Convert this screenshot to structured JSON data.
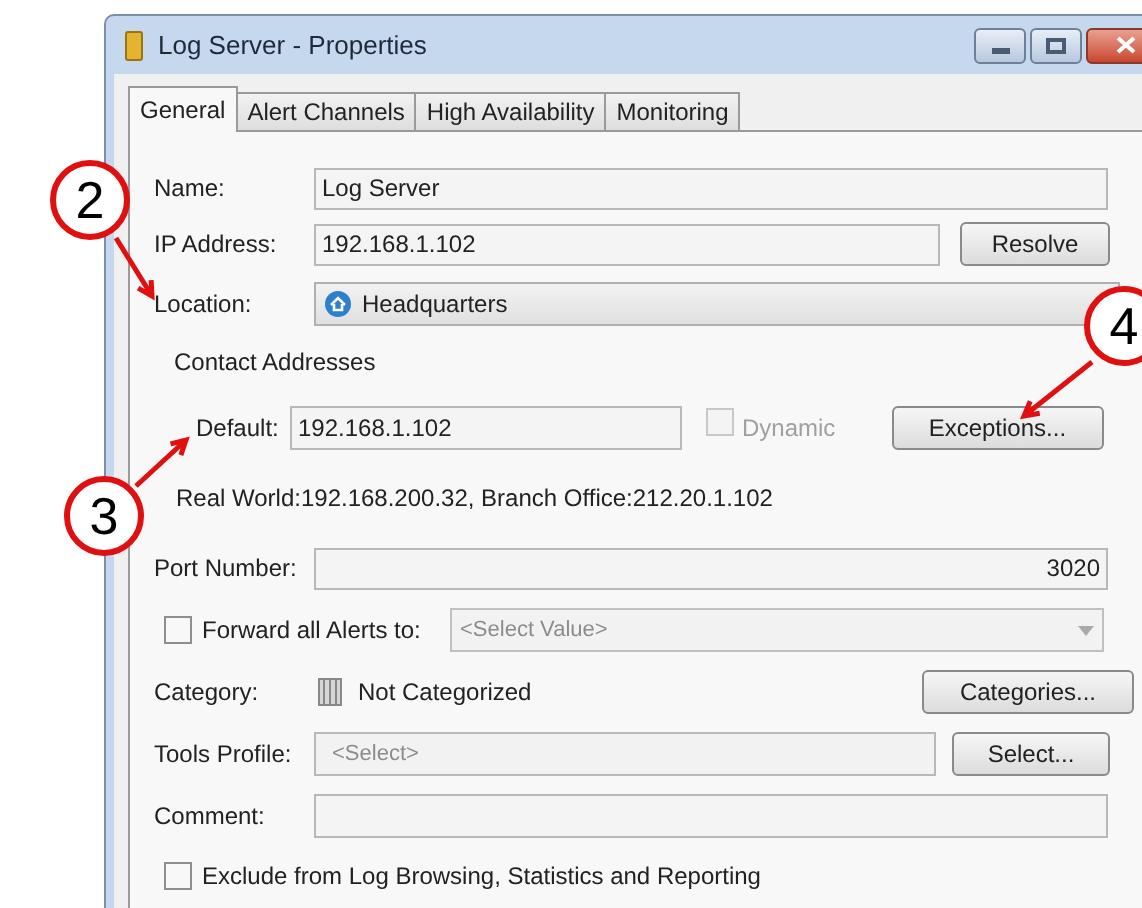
{
  "window": {
    "title": "Log Server - Properties"
  },
  "tabs": [
    {
      "label": "General",
      "selected": true
    },
    {
      "label": "Alert Channels",
      "selected": false
    },
    {
      "label": "High Availability",
      "selected": false
    },
    {
      "label": "Monitoring",
      "selected": false
    }
  ],
  "name": {
    "label": "Name:",
    "value": "Log Server"
  },
  "ip_address": {
    "label": "IP Address:",
    "value": "192.168.1.102",
    "button": "Resolve"
  },
  "location": {
    "label": "Location:",
    "value": "Headquarters"
  },
  "contact_addresses": {
    "heading": "Contact Addresses",
    "default_label": "Default:",
    "default_value": "192.168.1.102",
    "dynamic": {
      "label": "Dynamic",
      "checked": false,
      "disabled": true
    },
    "button": "Exceptions...",
    "summary": "Real World:192.168.200.32, Branch Office:212.20.1.102"
  },
  "port_number": {
    "label": "Port Number:",
    "value": "3020"
  },
  "forward_alerts": {
    "label": "Forward all Alerts to:",
    "checked": false,
    "placeholder": "<Select Value>"
  },
  "category": {
    "label": "Category:",
    "value": "Not Categorized",
    "button": "Categories..."
  },
  "tools_profile": {
    "label": "Tools Profile:",
    "placeholder": "<Select>",
    "button": "Select..."
  },
  "comment": {
    "label": "Comment:"
  },
  "exclude": {
    "label": "Exclude from Log Browsing, Statistics and Reporting",
    "checked": false
  },
  "callouts": [
    {
      "number": "2"
    },
    {
      "number": "3"
    },
    {
      "number": "4"
    }
  ]
}
